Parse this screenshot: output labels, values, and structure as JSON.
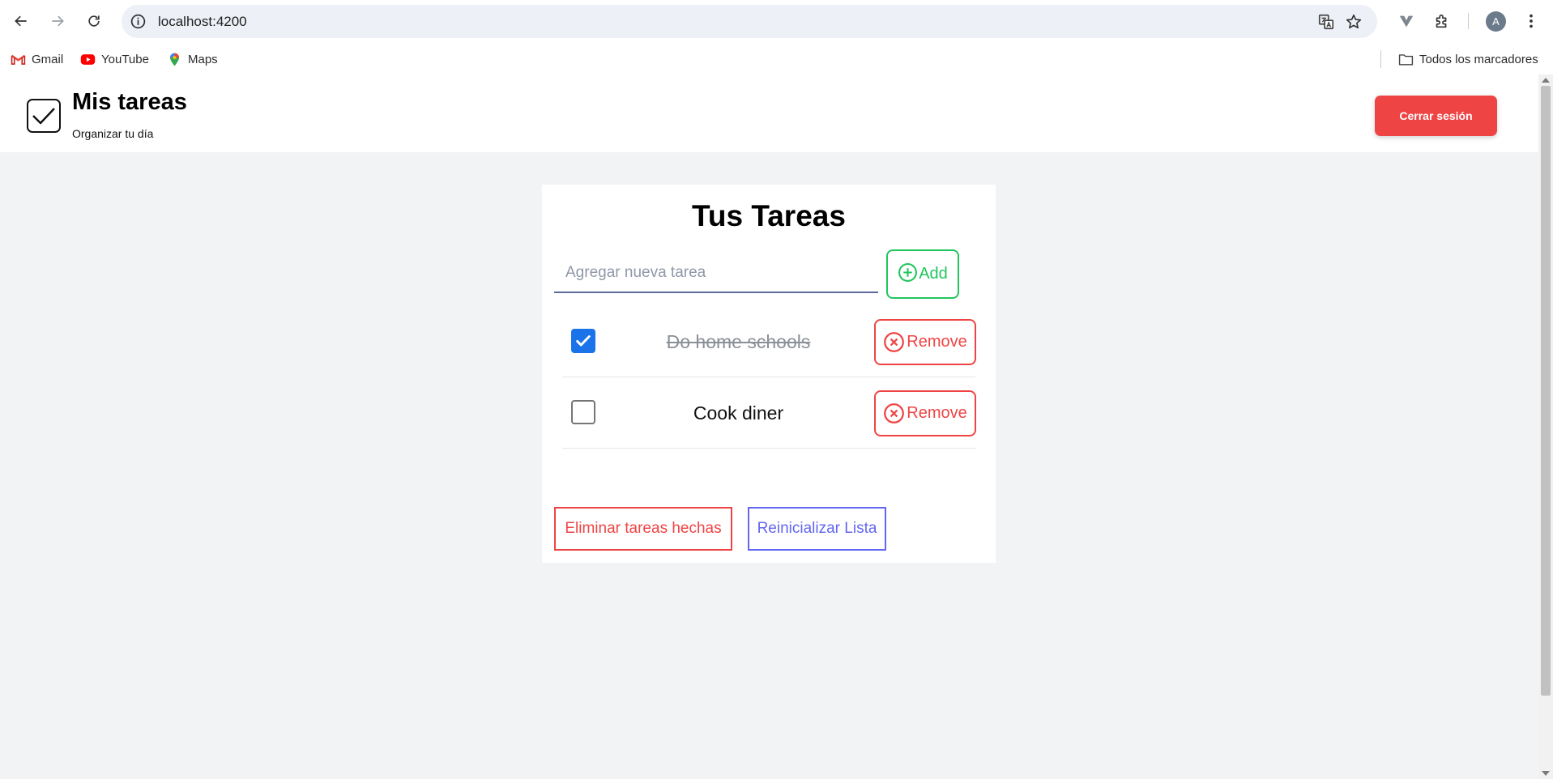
{
  "browser": {
    "url": "localhost:4200",
    "avatar_initial": "A",
    "bookmarks": [
      {
        "label": "Gmail",
        "icon": "gmail-icon"
      },
      {
        "label": "YouTube",
        "icon": "youtube-icon"
      },
      {
        "label": "Maps",
        "icon": "maps-icon"
      }
    ],
    "all_bookmarks_label": "Todos los marcadores"
  },
  "header": {
    "title": "Mis tareas",
    "subtitle": "Organizar tu día",
    "logout_label": "Cerrar sesión",
    "logout_color": "#ef4444"
  },
  "tasks_card": {
    "title": "Tus Tareas",
    "input_placeholder": "Agregar nueva tarea",
    "input_value": "",
    "add_label": "Add",
    "tasks": [
      {
        "text": "Do home schools",
        "done": true,
        "remove_label": "Remove"
      },
      {
        "text": "Cook diner",
        "done": false,
        "remove_label": "Remove"
      }
    ],
    "clear_done_label": "Eliminar tareas hechas",
    "reset_label": "Reinicializar Lista"
  },
  "colors": {
    "add_green": "#22c55e",
    "remove_red": "#ef4444",
    "reset_indigo": "#6366f1",
    "checkbox_blue": "#1a73e8"
  }
}
